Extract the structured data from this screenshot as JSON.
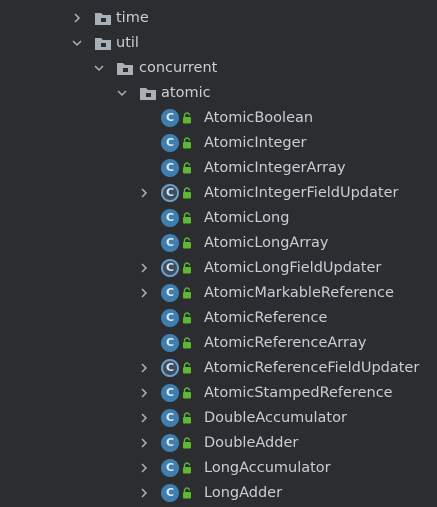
{
  "tree": {
    "time": {
      "label": "time",
      "icon": "folder-icon"
    },
    "util": {
      "label": "util",
      "icon": "folder-icon"
    },
    "concurrent": {
      "label": "concurrent",
      "icon": "folder-icon"
    },
    "atomic": {
      "label": "atomic",
      "icon": "folder-icon"
    },
    "classes": [
      {
        "label": "AtomicBoolean",
        "icon_letter": "C"
      },
      {
        "label": "AtomicInteger",
        "icon_letter": "C"
      },
      {
        "label": "AtomicIntegerArray",
        "icon_letter": "C"
      },
      {
        "label": "AtomicIntegerFieldUpdater",
        "icon_letter": "C"
      },
      {
        "label": "AtomicLong",
        "icon_letter": "C"
      },
      {
        "label": "AtomicLongArray",
        "icon_letter": "C"
      },
      {
        "label": "AtomicLongFieldUpdater",
        "icon_letter": "C"
      },
      {
        "label": "AtomicMarkableReference",
        "icon_letter": "C"
      },
      {
        "label": "AtomicReference",
        "icon_letter": "C"
      },
      {
        "label": "AtomicReferenceArray",
        "icon_letter": "C"
      },
      {
        "label": "AtomicReferenceFieldUpdater",
        "icon_letter": "C"
      },
      {
        "label": "AtomicStampedReference",
        "icon_letter": "C"
      },
      {
        "label": "DoubleAccumulator",
        "icon_letter": "C"
      },
      {
        "label": "DoubleAdder",
        "icon_letter": "C"
      },
      {
        "label": "LongAccumulator",
        "icon_letter": "C"
      },
      {
        "label": "LongAdder",
        "icon_letter": "C"
      }
    ]
  },
  "colors": {
    "background": "#2b2d30",
    "text": "#cbcfd4",
    "class_icon": "#3f7fb0",
    "lock_icon": "#5fb832",
    "folder_icon": "#a9b0b8"
  }
}
